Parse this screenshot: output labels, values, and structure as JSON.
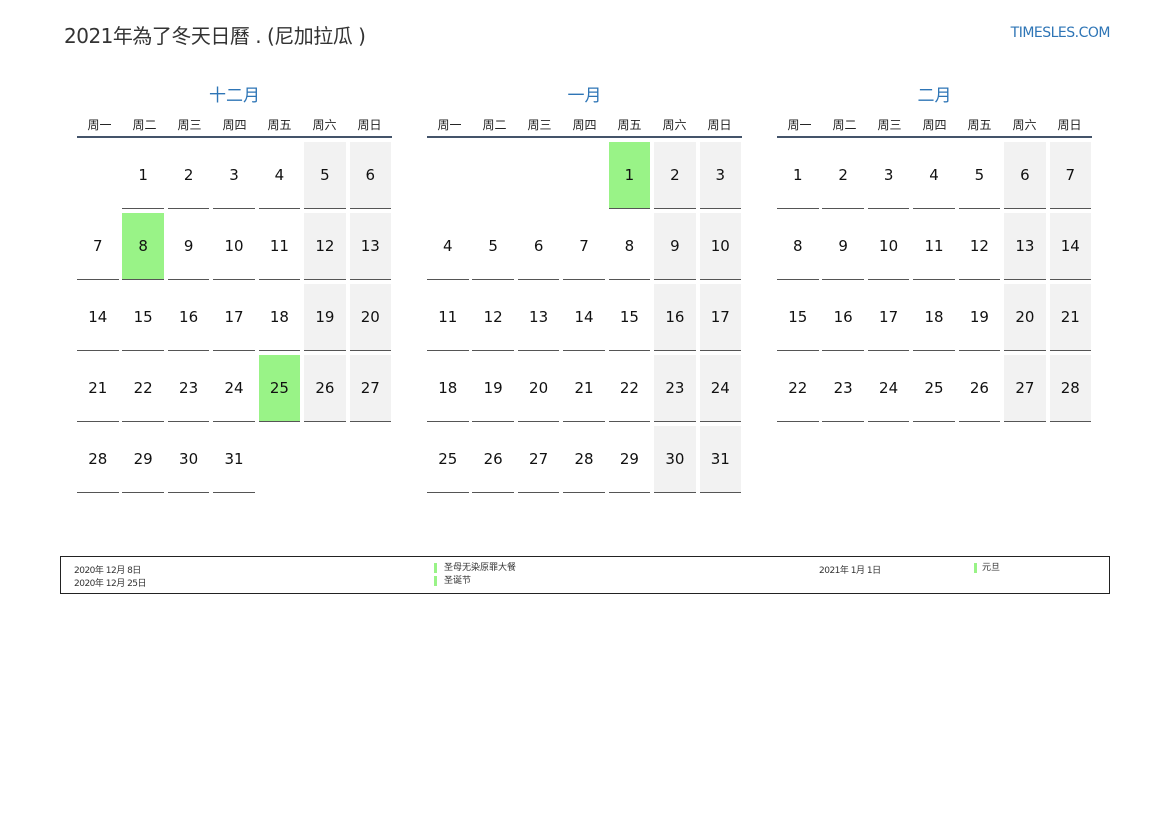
{
  "header": {
    "title": "2021年為了冬天日曆 . (尼加拉瓜 )",
    "site": "TIMESLES.COM"
  },
  "weekdays": [
    "周一",
    "周二",
    "周三",
    "周四",
    "周五",
    "周六",
    "周日"
  ],
  "months": [
    {
      "name": "十二月",
      "cells": [
        {
          "d": "",
          "t": "empty"
        },
        {
          "d": "1",
          "t": ""
        },
        {
          "d": "2",
          "t": ""
        },
        {
          "d": "3",
          "t": ""
        },
        {
          "d": "4",
          "t": ""
        },
        {
          "d": "5",
          "t": "wk"
        },
        {
          "d": "6",
          "t": "wk"
        },
        {
          "d": "7",
          "t": ""
        },
        {
          "d": "8",
          "t": "hol"
        },
        {
          "d": "9",
          "t": ""
        },
        {
          "d": "10",
          "t": ""
        },
        {
          "d": "11",
          "t": ""
        },
        {
          "d": "12",
          "t": "wk"
        },
        {
          "d": "13",
          "t": "wk"
        },
        {
          "d": "14",
          "t": ""
        },
        {
          "d": "15",
          "t": ""
        },
        {
          "d": "16",
          "t": ""
        },
        {
          "d": "17",
          "t": ""
        },
        {
          "d": "18",
          "t": ""
        },
        {
          "d": "19",
          "t": "wk"
        },
        {
          "d": "20",
          "t": "wk"
        },
        {
          "d": "21",
          "t": ""
        },
        {
          "d": "22",
          "t": ""
        },
        {
          "d": "23",
          "t": ""
        },
        {
          "d": "24",
          "t": ""
        },
        {
          "d": "25",
          "t": "hol"
        },
        {
          "d": "26",
          "t": "wk"
        },
        {
          "d": "27",
          "t": "wk"
        },
        {
          "d": "28",
          "t": ""
        },
        {
          "d": "29",
          "t": ""
        },
        {
          "d": "30",
          "t": ""
        },
        {
          "d": "31",
          "t": ""
        },
        {
          "d": "",
          "t": "empty"
        },
        {
          "d": "",
          "t": "empty"
        },
        {
          "d": "",
          "t": "empty"
        }
      ]
    },
    {
      "name": "一月",
      "cells": [
        {
          "d": "",
          "t": "empty"
        },
        {
          "d": "",
          "t": "empty"
        },
        {
          "d": "",
          "t": "empty"
        },
        {
          "d": "",
          "t": "empty"
        },
        {
          "d": "1",
          "t": "hol"
        },
        {
          "d": "2",
          "t": "wk"
        },
        {
          "d": "3",
          "t": "wk"
        },
        {
          "d": "4",
          "t": ""
        },
        {
          "d": "5",
          "t": ""
        },
        {
          "d": "6",
          "t": ""
        },
        {
          "d": "7",
          "t": ""
        },
        {
          "d": "8",
          "t": ""
        },
        {
          "d": "9",
          "t": "wk"
        },
        {
          "d": "10",
          "t": "wk"
        },
        {
          "d": "11",
          "t": ""
        },
        {
          "d": "12",
          "t": ""
        },
        {
          "d": "13",
          "t": ""
        },
        {
          "d": "14",
          "t": ""
        },
        {
          "d": "15",
          "t": ""
        },
        {
          "d": "16",
          "t": "wk"
        },
        {
          "d": "17",
          "t": "wk"
        },
        {
          "d": "18",
          "t": ""
        },
        {
          "d": "19",
          "t": ""
        },
        {
          "d": "20",
          "t": ""
        },
        {
          "d": "21",
          "t": ""
        },
        {
          "d": "22",
          "t": ""
        },
        {
          "d": "23",
          "t": "wk"
        },
        {
          "d": "24",
          "t": "wk"
        },
        {
          "d": "25",
          "t": ""
        },
        {
          "d": "26",
          "t": ""
        },
        {
          "d": "27",
          "t": ""
        },
        {
          "d": "28",
          "t": ""
        },
        {
          "d": "29",
          "t": ""
        },
        {
          "d": "30",
          "t": "wk"
        },
        {
          "d": "31",
          "t": "wk"
        }
      ]
    },
    {
      "name": "二月",
      "cells": [
        {
          "d": "1",
          "t": ""
        },
        {
          "d": "2",
          "t": ""
        },
        {
          "d": "3",
          "t": ""
        },
        {
          "d": "4",
          "t": ""
        },
        {
          "d": "5",
          "t": ""
        },
        {
          "d": "6",
          "t": "wk"
        },
        {
          "d": "7",
          "t": "wk"
        },
        {
          "d": "8",
          "t": ""
        },
        {
          "d": "9",
          "t": ""
        },
        {
          "d": "10",
          "t": ""
        },
        {
          "d": "11",
          "t": ""
        },
        {
          "d": "12",
          "t": ""
        },
        {
          "d": "13",
          "t": "wk"
        },
        {
          "d": "14",
          "t": "wk"
        },
        {
          "d": "15",
          "t": ""
        },
        {
          "d": "16",
          "t": ""
        },
        {
          "d": "17",
          "t": ""
        },
        {
          "d": "18",
          "t": ""
        },
        {
          "d": "19",
          "t": ""
        },
        {
          "d": "20",
          "t": "wk"
        },
        {
          "d": "21",
          "t": "wk"
        },
        {
          "d": "22",
          "t": ""
        },
        {
          "d": "23",
          "t": ""
        },
        {
          "d": "24",
          "t": ""
        },
        {
          "d": "25",
          "t": ""
        },
        {
          "d": "26",
          "t": ""
        },
        {
          "d": "27",
          "t": "wk"
        },
        {
          "d": "28",
          "t": "wk"
        }
      ]
    }
  ],
  "legend": [
    {
      "date": "2020年 12月 8日",
      "name": "圣母无染原罪大餐"
    },
    {
      "date": "2020年 12月 25日",
      "name": "圣诞节"
    },
    {
      "date": "2021年 1月 1日",
      "name": "元旦"
    }
  ],
  "colors": {
    "holiday": "#99f387",
    "weekend": "#f2f2f2",
    "accent": "#2e75b6"
  }
}
